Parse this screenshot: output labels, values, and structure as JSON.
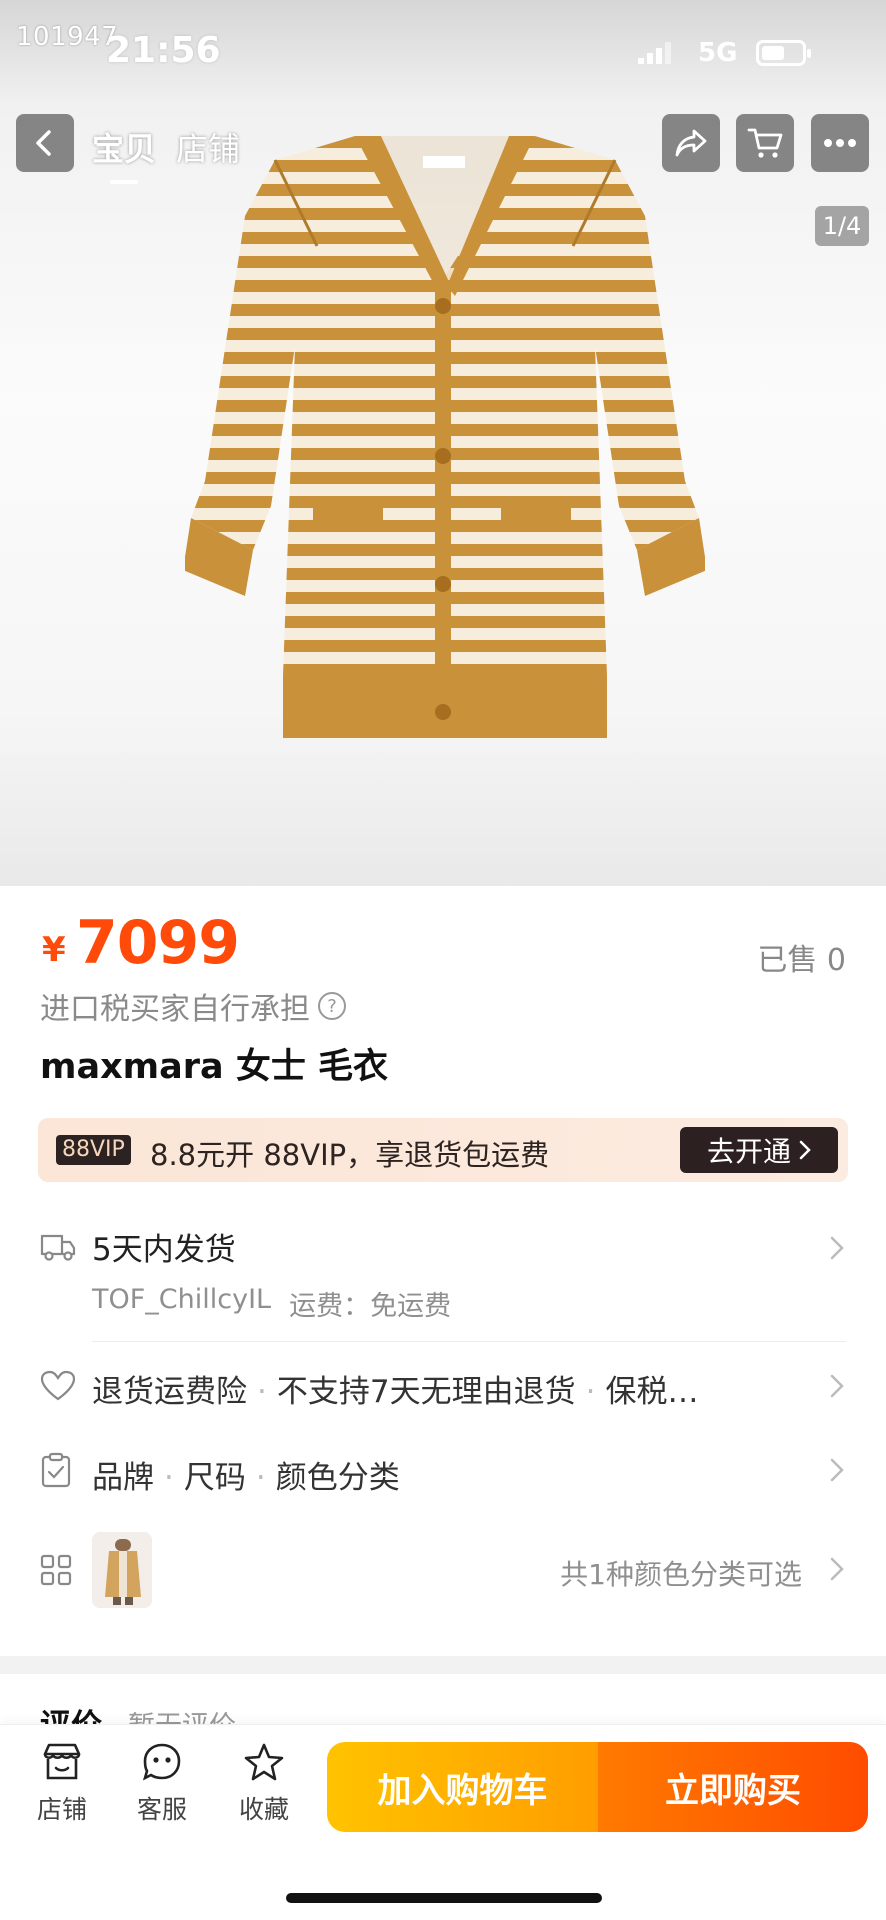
{
  "status_bar": {
    "watermark": "101947",
    "time": "21:56",
    "network": "5G"
  },
  "nav": {
    "tab_item": "宝贝",
    "tab_shop": "店铺",
    "image_counter": "1/4"
  },
  "product": {
    "currency": "¥",
    "price": "7099",
    "sold": "已售 0",
    "tax_note": "进口税买家自行承担",
    "title": "maxmara 女士 毛衣"
  },
  "vip": {
    "badge": "88VIP",
    "text": "8.8元开 88VIP，享退货包运费",
    "button": "去开通"
  },
  "shipping": {
    "title": "5天内发货",
    "seller": "TOF_ChillcyIL",
    "fee": "运费：免运费"
  },
  "services": [
    "退货运费险",
    "不支持7天无理由退货",
    "保税…"
  ],
  "specs": [
    "品牌",
    "尺码",
    "颜色分类"
  ],
  "sku": {
    "summary": "共1种颜色分类可选"
  },
  "review": {
    "title": "评价",
    "subtitle": "暂无评价"
  },
  "bottom_bar": {
    "shop": "店铺",
    "service": "客服",
    "favorite": "收藏",
    "add_to_cart": "加入购物车",
    "buy_now": "立即购买"
  },
  "colors": {
    "price": "#ff4a0a",
    "cart_button": "#ffb300",
    "buy_button": "#ff5a00",
    "garment": "#c8913a",
    "stripe": "#f7eddc"
  }
}
